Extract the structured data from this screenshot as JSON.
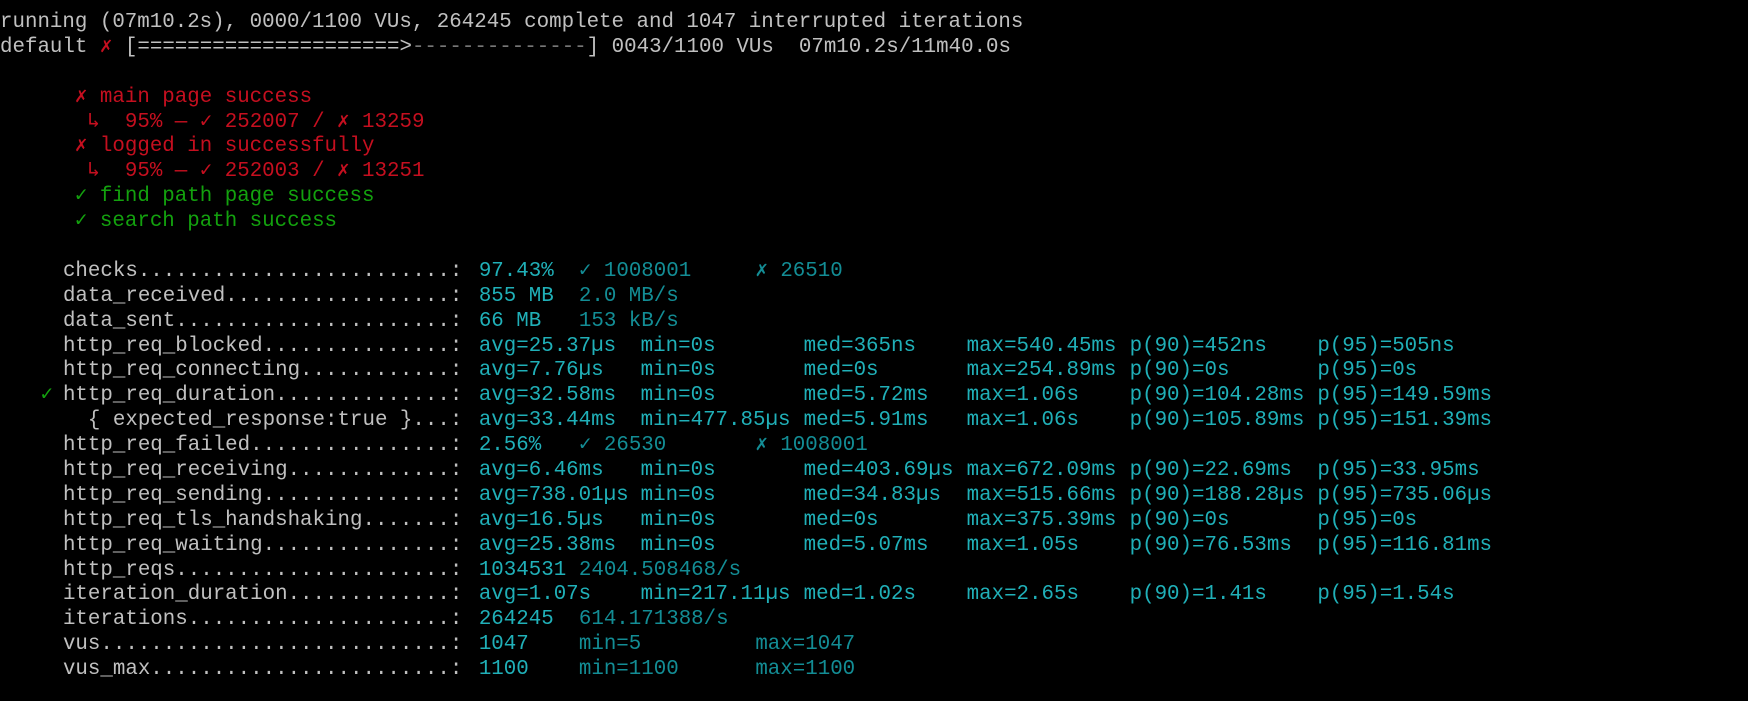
{
  "status": {
    "line1": "running (07m10.2s), 0000/1100 VUs, 264245 complete and 1047 interrupted iterations",
    "scenario_name": "default",
    "scenario_mark": "✗",
    "bar_open": "[",
    "bar_done": "=====================>",
    "bar_rest": "--------------",
    "bar_close": "]",
    "vus": "0043/1100 VUs",
    "time": "07m10.2s/11m40.0s",
    "progress": 0.614
  },
  "checks_list": [
    {
      "mark": "✗",
      "label": "main page success",
      "status": "fail",
      "detail": "↳  95% — ✓ 252007 / ✗ 13259"
    },
    {
      "mark": "✗",
      "label": "logged in successfully",
      "status": "fail",
      "detail": "↳  95% — ✓ 252003 / ✗ 13251"
    },
    {
      "mark": "✓",
      "label": "find path page success",
      "status": "pass"
    },
    {
      "mark": "✓",
      "label": "search path success",
      "status": "pass"
    }
  ],
  "metrics": [
    {
      "name": "checks.........................:",
      "v1": "97.43%",
      "v2": "✓ 1008001",
      "v3": "✗ 26510"
    },
    {
      "name": "data_received..................:",
      "v1": "855 MB",
      "v2": "2.0 MB/s"
    },
    {
      "name": "data_sent......................:",
      "v1": "66 MB",
      "v2": "153 kB/s"
    },
    {
      "name": "http_req_blocked...............:",
      "avg": "avg=25.37µs",
      "min": "min=0s",
      "med": "med=365ns",
      "max": "max=540.45ms",
      "p90": "p(90)=452ns",
      "p95": "p(95)=505ns"
    },
    {
      "name": "http_req_connecting............:",
      "avg": "avg=7.76µs",
      "min": "min=0s",
      "med": "med=0s",
      "max": "max=254.89ms",
      "p90": "p(90)=0s",
      "p95": "p(95)=0s"
    },
    {
      "name": "http_req_duration..............:",
      "mark": "✓",
      "avg": "avg=32.58ms",
      "min": "min=0s",
      "med": "med=5.72ms",
      "max": "max=1.06s",
      "p90": "p(90)=104.28ms",
      "p95": "p(95)=149.59ms"
    },
    {
      "name": "  { expected_response:true }...:",
      "avg": "avg=33.44ms",
      "min": "min=477.85µs",
      "med": "med=5.91ms",
      "max": "max=1.06s",
      "p90": "p(90)=105.89ms",
      "p95": "p(95)=151.39ms"
    },
    {
      "name": "http_req_failed................:",
      "v1": "2.56%",
      "v2": "✓ 26530",
      "v3": "✗ 1008001"
    },
    {
      "name": "http_req_receiving.............:",
      "avg": "avg=6.46ms",
      "min": "min=0s",
      "med": "med=403.69µs",
      "max": "max=672.09ms",
      "p90": "p(90)=22.69ms",
      "p95": "p(95)=33.95ms"
    },
    {
      "name": "http_req_sending...............:",
      "avg": "avg=738.01µs",
      "min": "min=0s",
      "med": "med=34.83µs",
      "max": "max=515.66ms",
      "p90": "p(90)=188.28µs",
      "p95": "p(95)=735.06µs"
    },
    {
      "name": "http_req_tls_handshaking.......:",
      "avg": "avg=16.5µs",
      "min": "min=0s",
      "med": "med=0s",
      "max": "max=375.39ms",
      "p90": "p(90)=0s",
      "p95": "p(95)=0s"
    },
    {
      "name": "http_req_waiting...............:",
      "avg": "avg=25.38ms",
      "min": "min=0s",
      "med": "med=5.07ms",
      "max": "max=1.05s",
      "p90": "p(90)=76.53ms",
      "p95": "p(95)=116.81ms"
    },
    {
      "name": "http_reqs......................:",
      "v1": "1034531",
      "v2": "2404.508468/s"
    },
    {
      "name": "iteration_duration.............:",
      "avg": "avg=1.07s",
      "min": "min=217.11µs",
      "med": "med=1.02s",
      "max": "max=2.65s",
      "p90": "p(90)=1.41s",
      "p95": "p(95)=1.54s"
    },
    {
      "name": "iterations.....................:",
      "v1": "264245",
      "v2": "614.171388/s"
    },
    {
      "name": "vus............................:",
      "v1": "1047",
      "v2": "min=5",
      "v3": "max=1047"
    },
    {
      "name": "vus_max........................:",
      "v1": "1100",
      "v2": "min=1100",
      "v3": "max=1100"
    }
  ],
  "colors": {
    "background": "#000000",
    "text": "#c0c0c0",
    "fail": "#c50f1f",
    "pass": "#13a10e",
    "value": "#20b0b8",
    "value_secondary": "#138d95"
  }
}
